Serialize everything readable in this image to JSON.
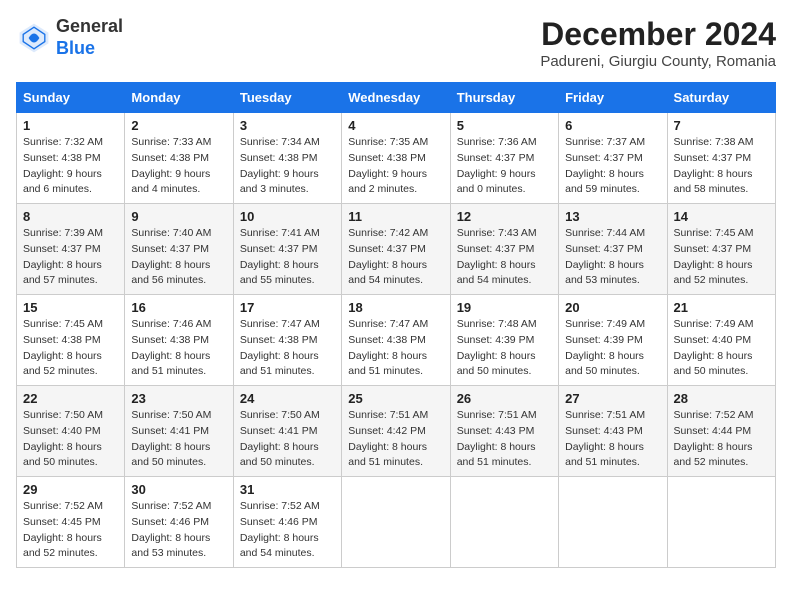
{
  "header": {
    "logo_line1": "General",
    "logo_line2": "Blue",
    "month_title": "December 2024",
    "subtitle": "Padureni, Giurgiu County, Romania"
  },
  "weekdays": [
    "Sunday",
    "Monday",
    "Tuesday",
    "Wednesday",
    "Thursday",
    "Friday",
    "Saturday"
  ],
  "weeks": [
    [
      {
        "day": "1",
        "sunrise": "7:32 AM",
        "sunset": "4:38 PM",
        "daylight": "9 hours and 6 minutes."
      },
      {
        "day": "2",
        "sunrise": "7:33 AM",
        "sunset": "4:38 PM",
        "daylight": "9 hours and 4 minutes."
      },
      {
        "day": "3",
        "sunrise": "7:34 AM",
        "sunset": "4:38 PM",
        "daylight": "9 hours and 3 minutes."
      },
      {
        "day": "4",
        "sunrise": "7:35 AM",
        "sunset": "4:38 PM",
        "daylight": "9 hours and 2 minutes."
      },
      {
        "day": "5",
        "sunrise": "7:36 AM",
        "sunset": "4:37 PM",
        "daylight": "9 hours and 0 minutes."
      },
      {
        "day": "6",
        "sunrise": "7:37 AM",
        "sunset": "4:37 PM",
        "daylight": "8 hours and 59 minutes."
      },
      {
        "day": "7",
        "sunrise": "7:38 AM",
        "sunset": "4:37 PM",
        "daylight": "8 hours and 58 minutes."
      }
    ],
    [
      {
        "day": "8",
        "sunrise": "7:39 AM",
        "sunset": "4:37 PM",
        "daylight": "8 hours and 57 minutes."
      },
      {
        "day": "9",
        "sunrise": "7:40 AM",
        "sunset": "4:37 PM",
        "daylight": "8 hours and 56 minutes."
      },
      {
        "day": "10",
        "sunrise": "7:41 AM",
        "sunset": "4:37 PM",
        "daylight": "8 hours and 55 minutes."
      },
      {
        "day": "11",
        "sunrise": "7:42 AM",
        "sunset": "4:37 PM",
        "daylight": "8 hours and 54 minutes."
      },
      {
        "day": "12",
        "sunrise": "7:43 AM",
        "sunset": "4:37 PM",
        "daylight": "8 hours and 54 minutes."
      },
      {
        "day": "13",
        "sunrise": "7:44 AM",
        "sunset": "4:37 PM",
        "daylight": "8 hours and 53 minutes."
      },
      {
        "day": "14",
        "sunrise": "7:45 AM",
        "sunset": "4:37 PM",
        "daylight": "8 hours and 52 minutes."
      }
    ],
    [
      {
        "day": "15",
        "sunrise": "7:45 AM",
        "sunset": "4:38 PM",
        "daylight": "8 hours and 52 minutes."
      },
      {
        "day": "16",
        "sunrise": "7:46 AM",
        "sunset": "4:38 PM",
        "daylight": "8 hours and 51 minutes."
      },
      {
        "day": "17",
        "sunrise": "7:47 AM",
        "sunset": "4:38 PM",
        "daylight": "8 hours and 51 minutes."
      },
      {
        "day": "18",
        "sunrise": "7:47 AM",
        "sunset": "4:38 PM",
        "daylight": "8 hours and 51 minutes."
      },
      {
        "day": "19",
        "sunrise": "7:48 AM",
        "sunset": "4:39 PM",
        "daylight": "8 hours and 50 minutes."
      },
      {
        "day": "20",
        "sunrise": "7:49 AM",
        "sunset": "4:39 PM",
        "daylight": "8 hours and 50 minutes."
      },
      {
        "day": "21",
        "sunrise": "7:49 AM",
        "sunset": "4:40 PM",
        "daylight": "8 hours and 50 minutes."
      }
    ],
    [
      {
        "day": "22",
        "sunrise": "7:50 AM",
        "sunset": "4:40 PM",
        "daylight": "8 hours and 50 minutes."
      },
      {
        "day": "23",
        "sunrise": "7:50 AM",
        "sunset": "4:41 PM",
        "daylight": "8 hours and 50 minutes."
      },
      {
        "day": "24",
        "sunrise": "7:50 AM",
        "sunset": "4:41 PM",
        "daylight": "8 hours and 50 minutes."
      },
      {
        "day": "25",
        "sunrise": "7:51 AM",
        "sunset": "4:42 PM",
        "daylight": "8 hours and 51 minutes."
      },
      {
        "day": "26",
        "sunrise": "7:51 AM",
        "sunset": "4:43 PM",
        "daylight": "8 hours and 51 minutes."
      },
      {
        "day": "27",
        "sunrise": "7:51 AM",
        "sunset": "4:43 PM",
        "daylight": "8 hours and 51 minutes."
      },
      {
        "day": "28",
        "sunrise": "7:52 AM",
        "sunset": "4:44 PM",
        "daylight": "8 hours and 52 minutes."
      }
    ],
    [
      {
        "day": "29",
        "sunrise": "7:52 AM",
        "sunset": "4:45 PM",
        "daylight": "8 hours and 52 minutes."
      },
      {
        "day": "30",
        "sunrise": "7:52 AM",
        "sunset": "4:46 PM",
        "daylight": "8 hours and 53 minutes."
      },
      {
        "day": "31",
        "sunrise": "7:52 AM",
        "sunset": "4:46 PM",
        "daylight": "8 hours and 54 minutes."
      },
      null,
      null,
      null,
      null
    ]
  ]
}
